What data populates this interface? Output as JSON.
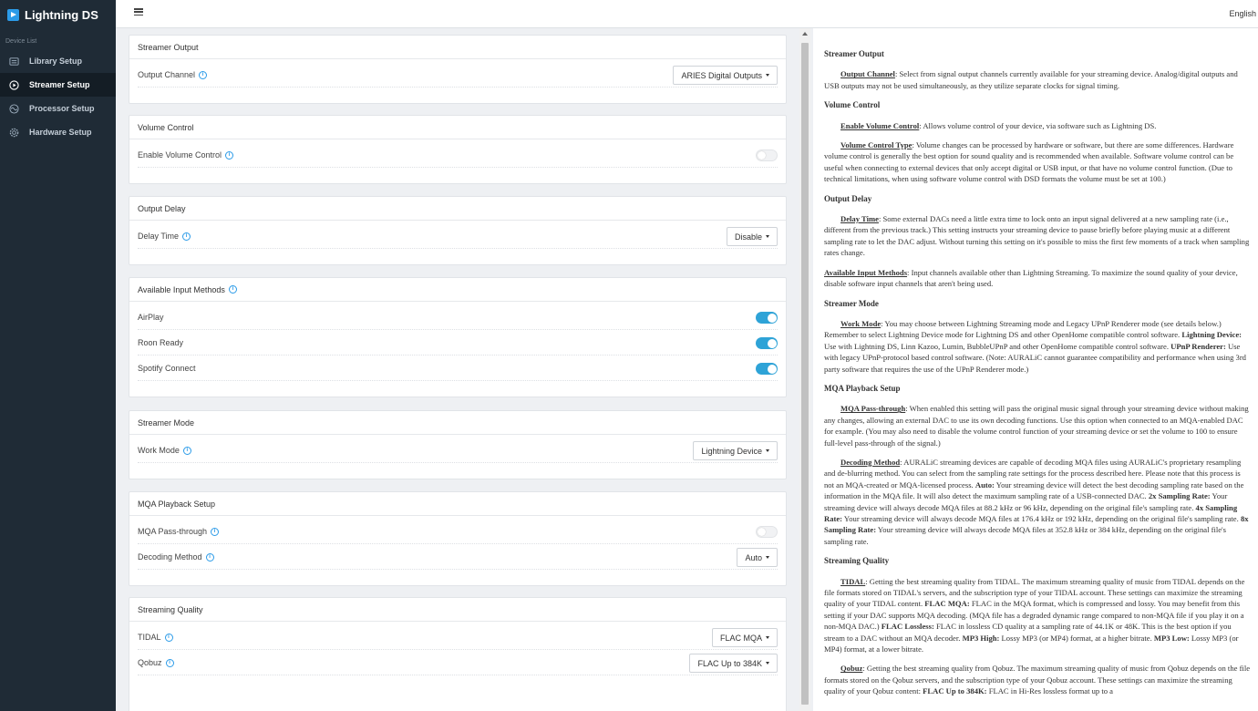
{
  "app": {
    "title": "Lightning DS"
  },
  "sidebar": {
    "section_label": "Device List",
    "items": [
      {
        "label": "Library Setup",
        "icon": "library-icon"
      },
      {
        "label": "Streamer Setup",
        "icon": "play-circle-icon",
        "active": true
      },
      {
        "label": "Processor Setup",
        "icon": "processor-icon"
      },
      {
        "label": "Hardware Setup",
        "icon": "gear-icon"
      }
    ]
  },
  "topbar": {
    "language": "English"
  },
  "panels": {
    "streamer_output": {
      "title": "Streamer Output",
      "output_channel_label": "Output Channel",
      "output_channel_value": "ARIES Digital Outputs"
    },
    "volume_control": {
      "title": "Volume Control",
      "enable_label": "Enable Volume Control",
      "enable_on": false
    },
    "output_delay": {
      "title": "Output Delay",
      "delay_label": "Delay Time",
      "delay_value": "Disable"
    },
    "inputs": {
      "title": "Available Input Methods",
      "items": [
        {
          "label": "AirPlay",
          "on": true
        },
        {
          "label": "Roon Ready",
          "on": true
        },
        {
          "label": "Spotify Connect",
          "on": true
        }
      ]
    },
    "streamer_mode": {
      "title": "Streamer Mode",
      "work_mode_label": "Work Mode",
      "work_mode_value": "Lightning Device"
    },
    "mqa": {
      "title": "MQA Playback Setup",
      "pass_label": "MQA Pass-through",
      "pass_on": false,
      "decoding_label": "Decoding Method",
      "decoding_value": "Auto"
    },
    "quality": {
      "title": "Streaming Quality",
      "tidal_label": "TIDAL",
      "tidal_value": "FLAC MQA",
      "qobuz_label": "Qobuz",
      "qobuz_value": "FLAC Up to 384K"
    }
  },
  "colors": {
    "accent": "#2ea3d7",
    "sidebar_bg": "#1f2b36",
    "sidebar_active": "#141d25"
  },
  "help": {
    "h_streamer_output": "Streamer Output",
    "output_channel_term": "Output Channel",
    "output_channel_text": ": Select from signal output channels currently available for your streaming device. Analog/digital outputs and USB outputs may not be used simultaneously, as they utilize separate clocks for signal timing.",
    "h_volume": "Volume Control",
    "enable_vc_term": "Enable Volume Control",
    "enable_vc_text": ": Allows volume control of your device, via software such as Lightning DS.",
    "vc_type_term": "Volume Control Type",
    "vc_type_text": ": Volume changes can be processed by hardware or software, but there are some differences. Hardware volume control is generally the best option for sound quality and is recommended when available. Software volume control can be useful when connecting to external devices that only accept digital or USB input, or that have no volume control function. (Due to technical limitations, when using software volume control with DSD formats the volume must be set at 100.)",
    "h_delay": "Output Delay",
    "delay_term": "Delay Time",
    "delay_text": ": Some external DACs need a little extra time to lock onto an input signal delivered at a new sampling rate (i.e., different from the previous track.) This setting instructs your streaming device to pause briefly before playing music at a different sampling rate to let the DAC adjust. Without turning this setting on it's possible to miss the first few moments of a track when sampling rates change.",
    "inputs_term": "Available Input Methods",
    "inputs_text": ": Input channels available other than Lightning Streaming. To maximize the sound quality of your device, disable software input channels that aren't being used.",
    "h_mode": "Streamer Mode",
    "work_mode_term": "Work Mode",
    "work_mode_text": ": You may choose between Lightning Streaming mode and Legacy UPnP Renderer mode (see details below.) Remember to select Lightning Device mode for Lightning DS and other OpenHome compatible control software.",
    "ld_term": "Lightning Device:",
    "ld_text": " Use with Lightning DS, Linn Kazoo, Lumin, BubbleUPnP and other OpenHome compatible control software.",
    "upnp_term": "UPnP Renderer:",
    "upnp_text": " Use with legacy UPnP-protocol based control software. (Note: AURALiC cannot guarantee compatibility and performance when using 3rd party software that requires the use of the UPnP Renderer mode.)",
    "h_mqa": "MQA Playback Setup",
    "mqa_pass_term": "MQA Pass-through",
    "mqa_pass_text": ": When enabled this setting will pass the original music signal through your streaming device without making any changes, allowing an external DAC to use its own decoding functions. Use this option when connected to an MQA-enabled DAC for example. (You may also need to disable the volume control function of your streaming device or set the volume to 100 to ensure full-level pass-through of the signal.)",
    "decoding_term": "Decoding Method",
    "decoding_text": ": AURALiC streaming devices are capable of decoding MQA files using AURALiC's proprietary resampling and de-blurring method. You can select from the sampling rate settings for the process described here. Please note that this process is not an MQA-created or MQA-licensed process.",
    "auto_term": "Auto:",
    "auto_text": " Your streaming device will detect the best decoding sampling rate based on the information in the MQA file. It will also detect the maximum sampling rate of a USB-connected DAC.",
    "x2_term": "2x Sampling Rate:",
    "x2_text": " Your streaming device will always decode MQA files at 88.2 kHz or 96 kHz, depending on the original file's sampling rate.",
    "x4_term": "4x Sampling Rate:",
    "x4_text": " Your streaming device will always decode MQA files at 176.4 kHz or 192 kHz, depending on the original file's sampling rate.",
    "x8_term": "8x Sampling Rate:",
    "x8_text": " Your streaming device will always decode MQA files at 352.8 kHz or 384 kHz, depending on the original file's sampling rate.",
    "h_quality": "Streaming Quality",
    "tidal_term": "TIDAL",
    "tidal_text": ": Getting the best streaming quality from TIDAL. The maximum streaming quality of music from TIDAL depends on the file formats stored on TIDAL's servers, and the subscription type of your TIDAL account. These settings can maximize the streaming quality of your TIDAL content.",
    "flacmqa_term": "FLAC MQA:",
    "flacmqa_text": " FLAC in the MQA format, which is compressed and lossy. You may benefit from this setting if your DAC supports MQA decoding. (MQA file has a degraded dynamic range compared to non-MQA file if you play it on a non-MQA DAC.)",
    "flacll_term": "FLAC Lossless:",
    "flacll_text": " FLAC in lossless CD quality at a sampling rate of 44.1K or 48K. This is the best option if you stream to a DAC without an MQA decoder.",
    "mp3h_term": "MP3 High:",
    "mp3h_text": " Lossy MP3 (or MP4) format, at a higher bitrate.",
    "mp3l_term": "MP3 Low:",
    "mp3l_text": " Lossy MP3 (or MP4) format, at a lower bitrate.",
    "qobuz_term": "Qobuz",
    "qobuz_text": ": Getting the best streaming quality from Qobuz. The maximum streaming quality of music from Qobuz depends on the file formats stored on the Qobuz servers, and the subscription type of your Qobuz account. These settings can maximize the streaming quality of your Qobuz content:",
    "flac384_term": "FLAC Up to 384K:",
    "flac384_text": " FLAC in Hi-Res lossless format up to a"
  }
}
